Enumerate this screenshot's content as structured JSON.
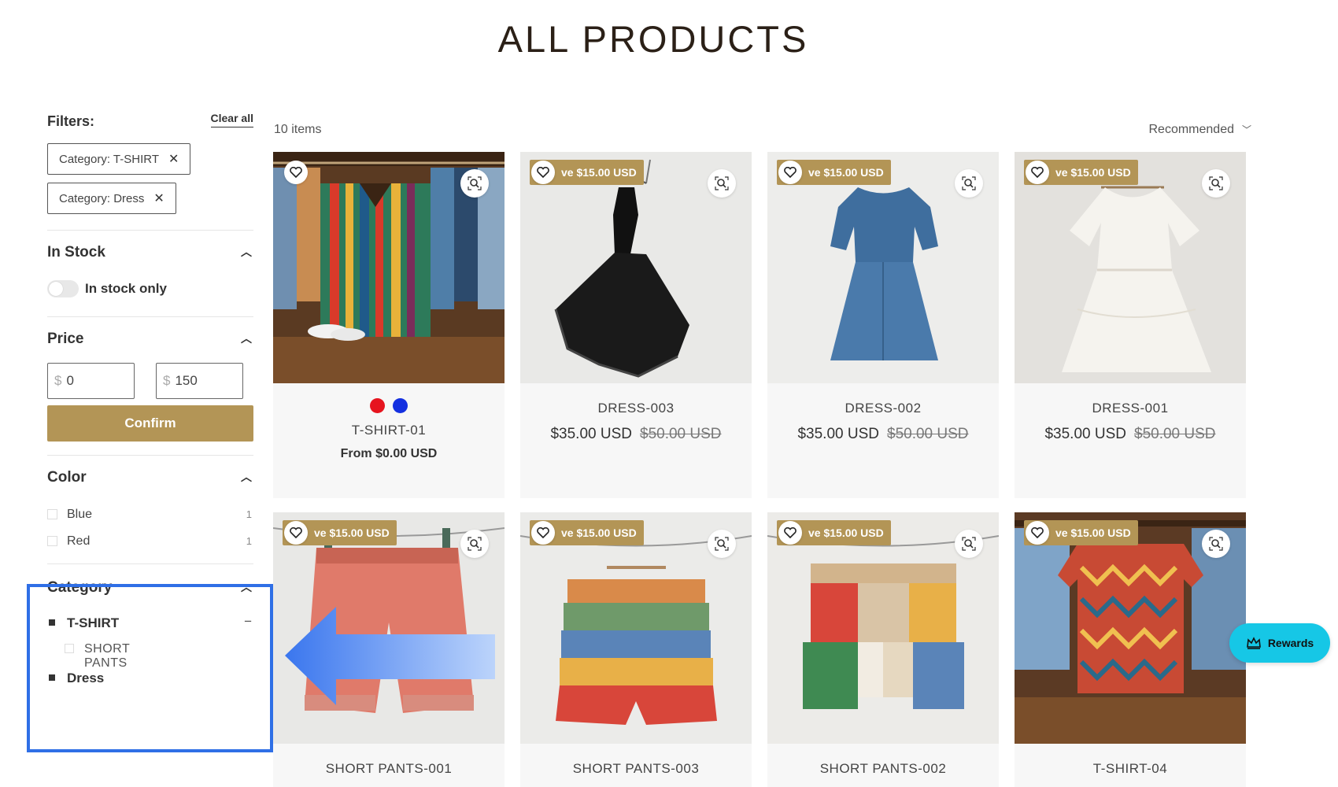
{
  "page": {
    "title": "ALL PRODUCTS"
  },
  "filters": {
    "label": "Filters:",
    "clear_all": "Clear all",
    "active": [
      "Category: T-SHIRT",
      "Category: Dress"
    ],
    "in_stock": {
      "title": "In Stock",
      "toggle_label": "In stock only",
      "enabled": false
    },
    "price": {
      "title": "Price",
      "currency_symbol": "$",
      "min": "0",
      "max": "150",
      "confirm": "Confirm"
    },
    "color": {
      "title": "Color",
      "options": [
        {
          "label": "Blue",
          "count": "1"
        },
        {
          "label": "Red",
          "count": "1"
        }
      ]
    },
    "category": {
      "title": "Category",
      "items": [
        {
          "label": "T-SHIRT",
          "expanded_icon": "−"
        },
        {
          "label": "SHORT PANTS"
        },
        {
          "label": "Dress"
        }
      ]
    }
  },
  "listing": {
    "count": "10 items",
    "sort": "Recommended"
  },
  "products": [
    {
      "name": "T-SHIRT-01",
      "price": "From $0.00 USD",
      "swatches": [
        "#e6141e",
        "#1430e0"
      ],
      "image": "tshirt-rack"
    },
    {
      "badge": "ve $15.00 USD",
      "name": "DRESS-003",
      "price": "$35.00 USD",
      "old_price": "$50.00 USD",
      "image": "black-dress"
    },
    {
      "badge": "ve $15.00 USD",
      "name": "DRESS-002",
      "price": "$35.00 USD",
      "old_price": "$50.00 USD",
      "image": "blue-dress"
    },
    {
      "badge": "ve $15.00 USD",
      "name": "DRESS-001",
      "price": "$35.00 USD",
      "old_price": "$50.00 USD",
      "image": "white-dress"
    },
    {
      "badge": "ve $15.00 USD",
      "name": "SHORT PANTS-001",
      "image": "red-shorts"
    },
    {
      "badge": "ve $15.00 USD",
      "name": "SHORT PANTS-003",
      "image": "striped-shorts"
    },
    {
      "badge": "ve $15.00 USD",
      "name": "SHORT PANTS-002",
      "image": "block-shorts"
    },
    {
      "badge": "ve $15.00 USD",
      "name": "T-SHIRT-04",
      "image": "zigzag-shirt"
    }
  ],
  "rewards": {
    "label": "Rewards"
  },
  "colors": {
    "accent": "#b39556",
    "highlight": "#2f6fe6",
    "rewards": "#16c7e6"
  }
}
